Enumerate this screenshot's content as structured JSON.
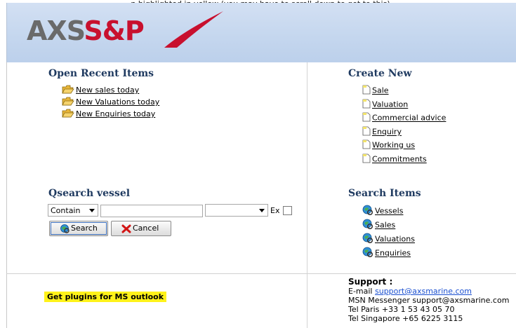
{
  "caption": "...n highlighted in yellow (you may have to scroll down to get to this).",
  "header": {
    "logo_part1": "AXS",
    "logo_part2": "S&P"
  },
  "open_recent": {
    "title": "Open Recent Items",
    "items": [
      "New sales today",
      "New Valuations today",
      "New Enquiries today"
    ]
  },
  "create_new": {
    "title": "Create New",
    "items": [
      "Sale",
      "Valuation",
      "Commercial advice",
      "Enquiry",
      "Working us",
      "Commitments"
    ]
  },
  "qsearch": {
    "title": "Qsearch vessel",
    "mode_selected": "Contain",
    "text_value": "",
    "second_select_value": "",
    "ex_label": "Ex",
    "ex_checked": false,
    "search_button": "Search",
    "cancel_button": "Cancel"
  },
  "search_items": {
    "title": "Search Items",
    "items": [
      "Vessels",
      "Sales",
      "Valuations",
      "Enquiries"
    ]
  },
  "plugins": {
    "label": "Get plugins for MS outlook"
  },
  "support": {
    "title": "Support :",
    "email_label": "E-mail",
    "email": "support@axsmarine.com",
    "messenger": "MSN Messenger support@axsmarine.com",
    "tel_paris": "Tel Paris +33 1 53 43 05 70",
    "tel_singapore": "Tel Singapore +65 6225 3115"
  },
  "colors": {
    "header_bg": "#c4d6ee",
    "section_title": "#1f3a60",
    "logo_gray": "#6a6a6a",
    "logo_red": "#c8102e",
    "highlight": "#fff21a",
    "link_blue": "#1a4fd0"
  }
}
